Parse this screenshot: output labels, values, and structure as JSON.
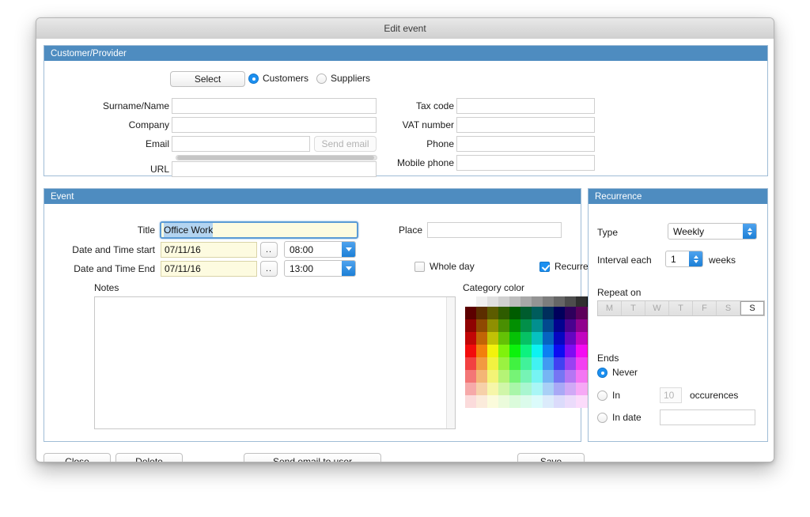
{
  "window": {
    "title": "Edit event"
  },
  "customer_panel": {
    "header": "Customer/Provider",
    "select_button": "Select",
    "radio_customers": "Customers",
    "radio_suppliers": "Suppliers",
    "radio_selected": "Customers",
    "fields_left": [
      {
        "label": "Surname/Name",
        "value": ""
      },
      {
        "label": "Company",
        "value": ""
      },
      {
        "label": "Email",
        "value": ""
      },
      {
        "label": "URL",
        "value": ""
      }
    ],
    "fields_right": [
      {
        "label": "Tax code",
        "value": ""
      },
      {
        "label": "VAT number",
        "value": ""
      },
      {
        "label": "Phone",
        "value": ""
      },
      {
        "label": "Mobile phone",
        "value": ""
      }
    ],
    "send_email_button": "Send email"
  },
  "event_panel": {
    "header": "Event",
    "title_label": "Title",
    "title_value": "Office Work",
    "date_start_label": "Date and Time start",
    "date_start_value": "07/11/16",
    "time_start_value": "08:00",
    "date_end_label": "Date and Time End",
    "date_end_value": "07/11/16",
    "time_end_value": "13:00",
    "date_picker_button": "..",
    "place_label": "Place",
    "place_value": "",
    "whole_day_label": "Whole day",
    "whole_day_checked": false,
    "recurrence_label": "Recurrence",
    "recurrence_checked": true,
    "notes_label": "Notes",
    "notes_value": "",
    "category_color_label": "Category color"
  },
  "recurrence_panel": {
    "header": "Recurrence",
    "type_label": "Type",
    "type_value": "Weekly",
    "interval_label": "Interval each",
    "interval_value": "1",
    "interval_unit": "weeks",
    "repeat_on_label": "Repeat on",
    "days": [
      {
        "label": "M",
        "selected": false
      },
      {
        "label": "T",
        "selected": false
      },
      {
        "label": "W",
        "selected": false
      },
      {
        "label": "T",
        "selected": false
      },
      {
        "label": "F",
        "selected": false
      },
      {
        "label": "S",
        "selected": false
      },
      {
        "label": "S",
        "selected": true
      }
    ],
    "ends_label": "Ends",
    "ends_never": "Never",
    "ends_in": "In",
    "ends_in_value": "10",
    "ends_in_unit": "occurences",
    "ends_in_date": "In date",
    "ends_in_date_value": "",
    "ends_selected": "Never"
  },
  "footer": {
    "close": "Close",
    "delete": "Delete",
    "send_email_to_user": "Send email to user",
    "save": "Save"
  },
  "colors": {
    "panel_header": "#4e8cc0",
    "panel_border": "#9fbcd6",
    "accent_blue": "#1b8ff0",
    "field_yellow": "#fdfbe0",
    "selection_blue": "#b3d4f0"
  },
  "palette": {
    "grayscale": [
      "#ffffff",
      "#f0f0f0",
      "#e0e0e0",
      "#d0d0d0",
      "#bdbdbd",
      "#a8a8a8",
      "#949494",
      "#7d7d7d",
      "#666666",
      "#4d4d4d",
      "#303030",
      "#000000"
    ],
    "hues": [
      0,
      30,
      60,
      90,
      120,
      150,
      180,
      210,
      240,
      270,
      300,
      330
    ],
    "rows": 8
  }
}
